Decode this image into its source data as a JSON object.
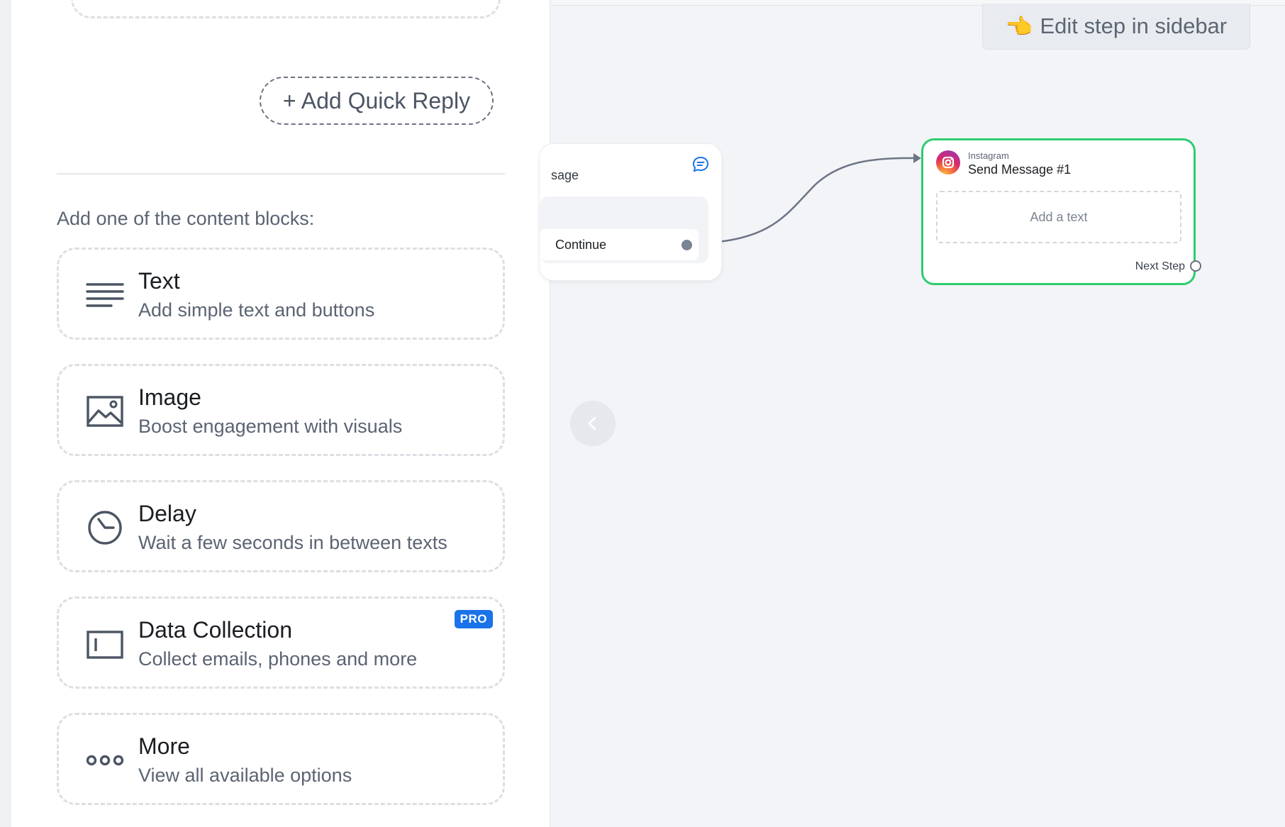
{
  "sidebar": {
    "quick_reply_label": "+ Add Quick Reply",
    "blocks_heading": "Add one of the content blocks:",
    "blocks": [
      {
        "title": "Text",
        "description": "Add simple text and buttons",
        "icon": "text-lines-icon"
      },
      {
        "title": "Image",
        "description": "Boost engagement with visuals",
        "icon": "image-icon"
      },
      {
        "title": "Delay",
        "description": "Wait a few seconds in between texts",
        "icon": "clock-icon"
      },
      {
        "title": "Data Collection",
        "description": "Collect emails, phones and more",
        "icon": "input-field-icon",
        "badge": "PRO"
      },
      {
        "title": "More",
        "description": "View all available options",
        "icon": "more-dots-icon"
      }
    ]
  },
  "canvas": {
    "edit_hint_emoji": "👈",
    "edit_hint": "Edit step in sidebar",
    "node_left": {
      "label_partial": "sage",
      "button_label": "Continue"
    },
    "node_right": {
      "platform": "Instagram",
      "name": "Send Message #1",
      "text_placeholder": "Add a text",
      "next_step": "Next Step"
    }
  },
  "colors": {
    "accent_green": "#2ecc71",
    "pro_badge": "#1a73e8"
  }
}
